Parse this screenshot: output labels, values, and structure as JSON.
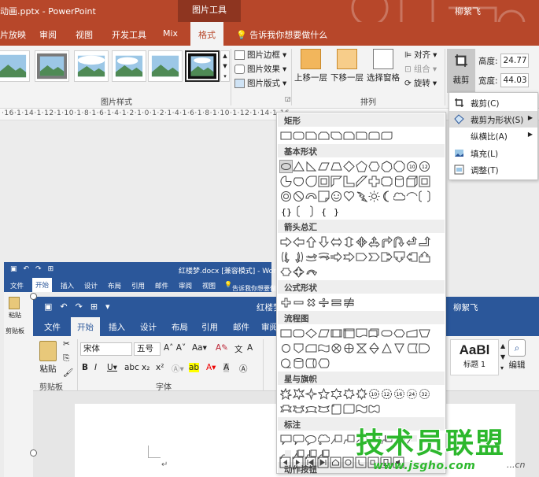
{
  "powerpoint": {
    "title": "动画.pptx - PowerPoint",
    "context_tab": "图片工具",
    "user": "柳絮飞",
    "tabs": [
      "片放映",
      "审阅",
      "视图",
      "开发工具",
      "Mix",
      "格式"
    ],
    "tell_me": "告诉我你想要做什么",
    "ribbon": {
      "picture_styles_label": "图片样式",
      "picture_border": "图片边框",
      "picture_effects": "图片效果",
      "picture_layout": "图片版式",
      "bring_forward": "上移一层",
      "send_backward": "下移一层",
      "selection_pane": "选择窗格",
      "align": "对齐",
      "group": "组合",
      "rotate": "旋转",
      "arrange_label": "排列",
      "crop": "裁剪",
      "height_label": "高度:",
      "height_value": "24.77",
      "width_label": "宽度:",
      "width_value": "44.03"
    },
    "ruler": "·16·1·14·1·12·1·10·1·8·1·6·1·4·1·2·1·0·1·2·1·4·1·6·1·8·1·10·1·12·1·14·1·16·"
  },
  "crop_menu": {
    "items": [
      "裁剪(C)",
      "裁剪为形状(S)",
      "纵横比(A)",
      "填充(L)",
      "调整(T)"
    ]
  },
  "shapes_menu": {
    "sections": [
      "矩形",
      "基本形状",
      "箭头总汇",
      "公式形状",
      "流程图",
      "星与旗帜",
      "标注",
      "动作按钮"
    ]
  },
  "word_small": {
    "title": "红楼梦.docx [兼容模式] - Word",
    "tell_me": "告诉我你想要做什么",
    "tabs": [
      "文件",
      "开始",
      "插入",
      "设计",
      "布局",
      "引用",
      "邮件",
      "审阅",
      "视图"
    ],
    "paste": "粘贴",
    "clipboard": "剪贴板"
  },
  "word": {
    "title": "红楼梦",
    "user": "柳絮飞",
    "tabs": [
      "文件",
      "开始",
      "插入",
      "设计",
      "布局",
      "引用",
      "邮件",
      "审阅"
    ],
    "paste": "粘贴",
    "clipboard": "剪贴板",
    "font_group": "字体",
    "font_name": "宋体",
    "font_size": "五号",
    "style_sample": "AaBl",
    "style_name": "标题 1",
    "edit": "编辑"
  },
  "watermark": {
    "text": "技术员联盟",
    "url": "www.jsgho.com",
    "suffix": "...cn"
  }
}
